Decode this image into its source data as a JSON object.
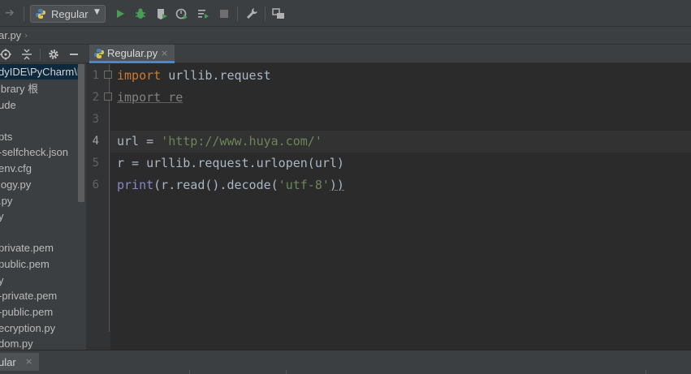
{
  "toolbar": {
    "run_config": "Regular",
    "icons": [
      "back-arrow-icon",
      "python-icon",
      "chevron-down-icon",
      "run-icon",
      "debug-icon",
      "coverage-icon",
      "profile-icon",
      "concurrency-icon",
      "stop-icon",
      "wrench-icon",
      "structure-icon"
    ],
    "colors": {
      "run": "#499c54",
      "debug": "#499c54",
      "stop": "#6e6e6e"
    }
  },
  "breadcrumb": {
    "file": "ar.py",
    "chevron": "›"
  },
  "project_panel": {
    "header_icons": [
      "target-icon",
      "collapse-icon",
      "gear-icon",
      "hide-icon"
    ],
    "items": [
      {
        "label": "dyIDE\\PyCharm\\Py",
        "selected": true
      },
      {
        "label": "ibrary 根",
        "selected": false
      },
      {
        "label": "ude",
        "selected": false
      },
      {
        "label": "",
        "selected": false
      },
      {
        "label": "pts",
        "selected": false
      },
      {
        "label": "-selfcheck.json",
        "selected": false
      },
      {
        "label": "env.cfg",
        "selected": false
      },
      {
        "label": "logy.py",
        "selected": false
      },
      {
        "label": ".py",
        "selected": false
      },
      {
        "label": "y",
        "selected": false
      },
      {
        "label": "",
        "selected": false
      },
      {
        "label": "private.pem",
        "selected": false
      },
      {
        "label": "public.pem",
        "selected": false
      },
      {
        "label": "y",
        "selected": false
      },
      {
        "label": "-private.pem",
        "selected": false
      },
      {
        "label": "-public.pem",
        "selected": false
      },
      {
        "label": "ecryption.py",
        "selected": false
      },
      {
        "label": "dom.py",
        "selected": false
      }
    ]
  },
  "editor": {
    "tab_label": "Regular.py",
    "tab_close": "×",
    "line_numbers": [
      "1",
      "2",
      "3",
      "4",
      "5",
      "6"
    ],
    "current_line": "4",
    "code": {
      "l1_kw": "import",
      "l1_rest": " urllib.request",
      "l2_text": "import re",
      "l4_a": "url = ",
      "l4_str": "'http://www.huya.com/'",
      "l5_text": "r = urllib.request.urlopen(url)",
      "l6_print": "print",
      "l6_a": "(r.read().decode(",
      "l6_str": "'utf-8'",
      "l6_b": "))"
    },
    "colors": {
      "keyword": "#cc7832",
      "string": "#6a8759",
      "builtin": "#8888c6",
      "text": "#a9b7c6"
    }
  },
  "bottom": {
    "run_tab_label": "ular",
    "close": "×"
  }
}
